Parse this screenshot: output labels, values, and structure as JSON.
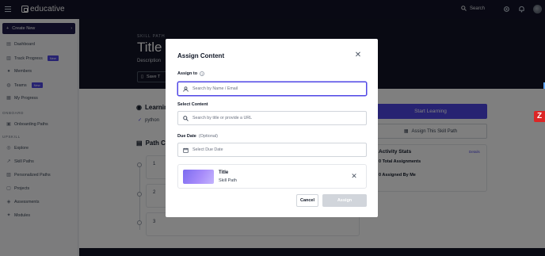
{
  "app": {
    "logo_text": "educative"
  },
  "topbar": {
    "search_label": "Search"
  },
  "sidebar": {
    "create_label": "Create New",
    "items": [
      {
        "label": "Dashboard"
      },
      {
        "label": "Track Progress",
        "badge": "New"
      },
      {
        "label": "Members"
      },
      {
        "label": "Teams",
        "badge": "New"
      },
      {
        "label": "My Progress"
      }
    ],
    "onboard_section": "ONBOARD",
    "onboard_items": [
      {
        "label": "Onboarding Paths"
      }
    ],
    "upskill_section": "UPSKILL",
    "upskill_items": [
      {
        "label": "Explore"
      },
      {
        "label": "Skill Paths"
      },
      {
        "label": "Personalized Paths"
      },
      {
        "label": "Projects"
      },
      {
        "label": "Assessments"
      },
      {
        "label": "Modules"
      }
    ]
  },
  "hero": {
    "eyebrow": "SKILL PATH",
    "title": "Title",
    "description": "Description",
    "save_label": "Save T"
  },
  "learn": {
    "heading": "Learnin",
    "item": "python"
  },
  "path": {
    "heading": "Path C",
    "steps": [
      "1",
      "2",
      "3"
    ]
  },
  "right_panel": {
    "start_label": "Start Learning",
    "assign_path_label": "Assign This Skill Path",
    "activity_title": "Activity Stats",
    "details_link": "Details",
    "total_assignments": "0 Total Assignments",
    "assigned_by_me": "0 Assigned By Me"
  },
  "modal": {
    "title": "Assign Content",
    "assign_to_label": "Assign to",
    "assign_to_placeholder": "Search by Name / Email",
    "select_content_label": "Select Content",
    "select_content_placeholder": "Search by title or provide a URL",
    "due_date_label": "Due Date",
    "due_date_optional": "(Optional)",
    "due_date_placeholder": "Select Due Date",
    "content_card": {
      "title": "Title",
      "subtitle": "Skill Path"
    },
    "cancel_label": "Cancel",
    "assign_label": "Assign"
  },
  "colors": {
    "primary": "#4f46e5",
    "dark": "#131427",
    "disabled": "#d1d5db"
  }
}
